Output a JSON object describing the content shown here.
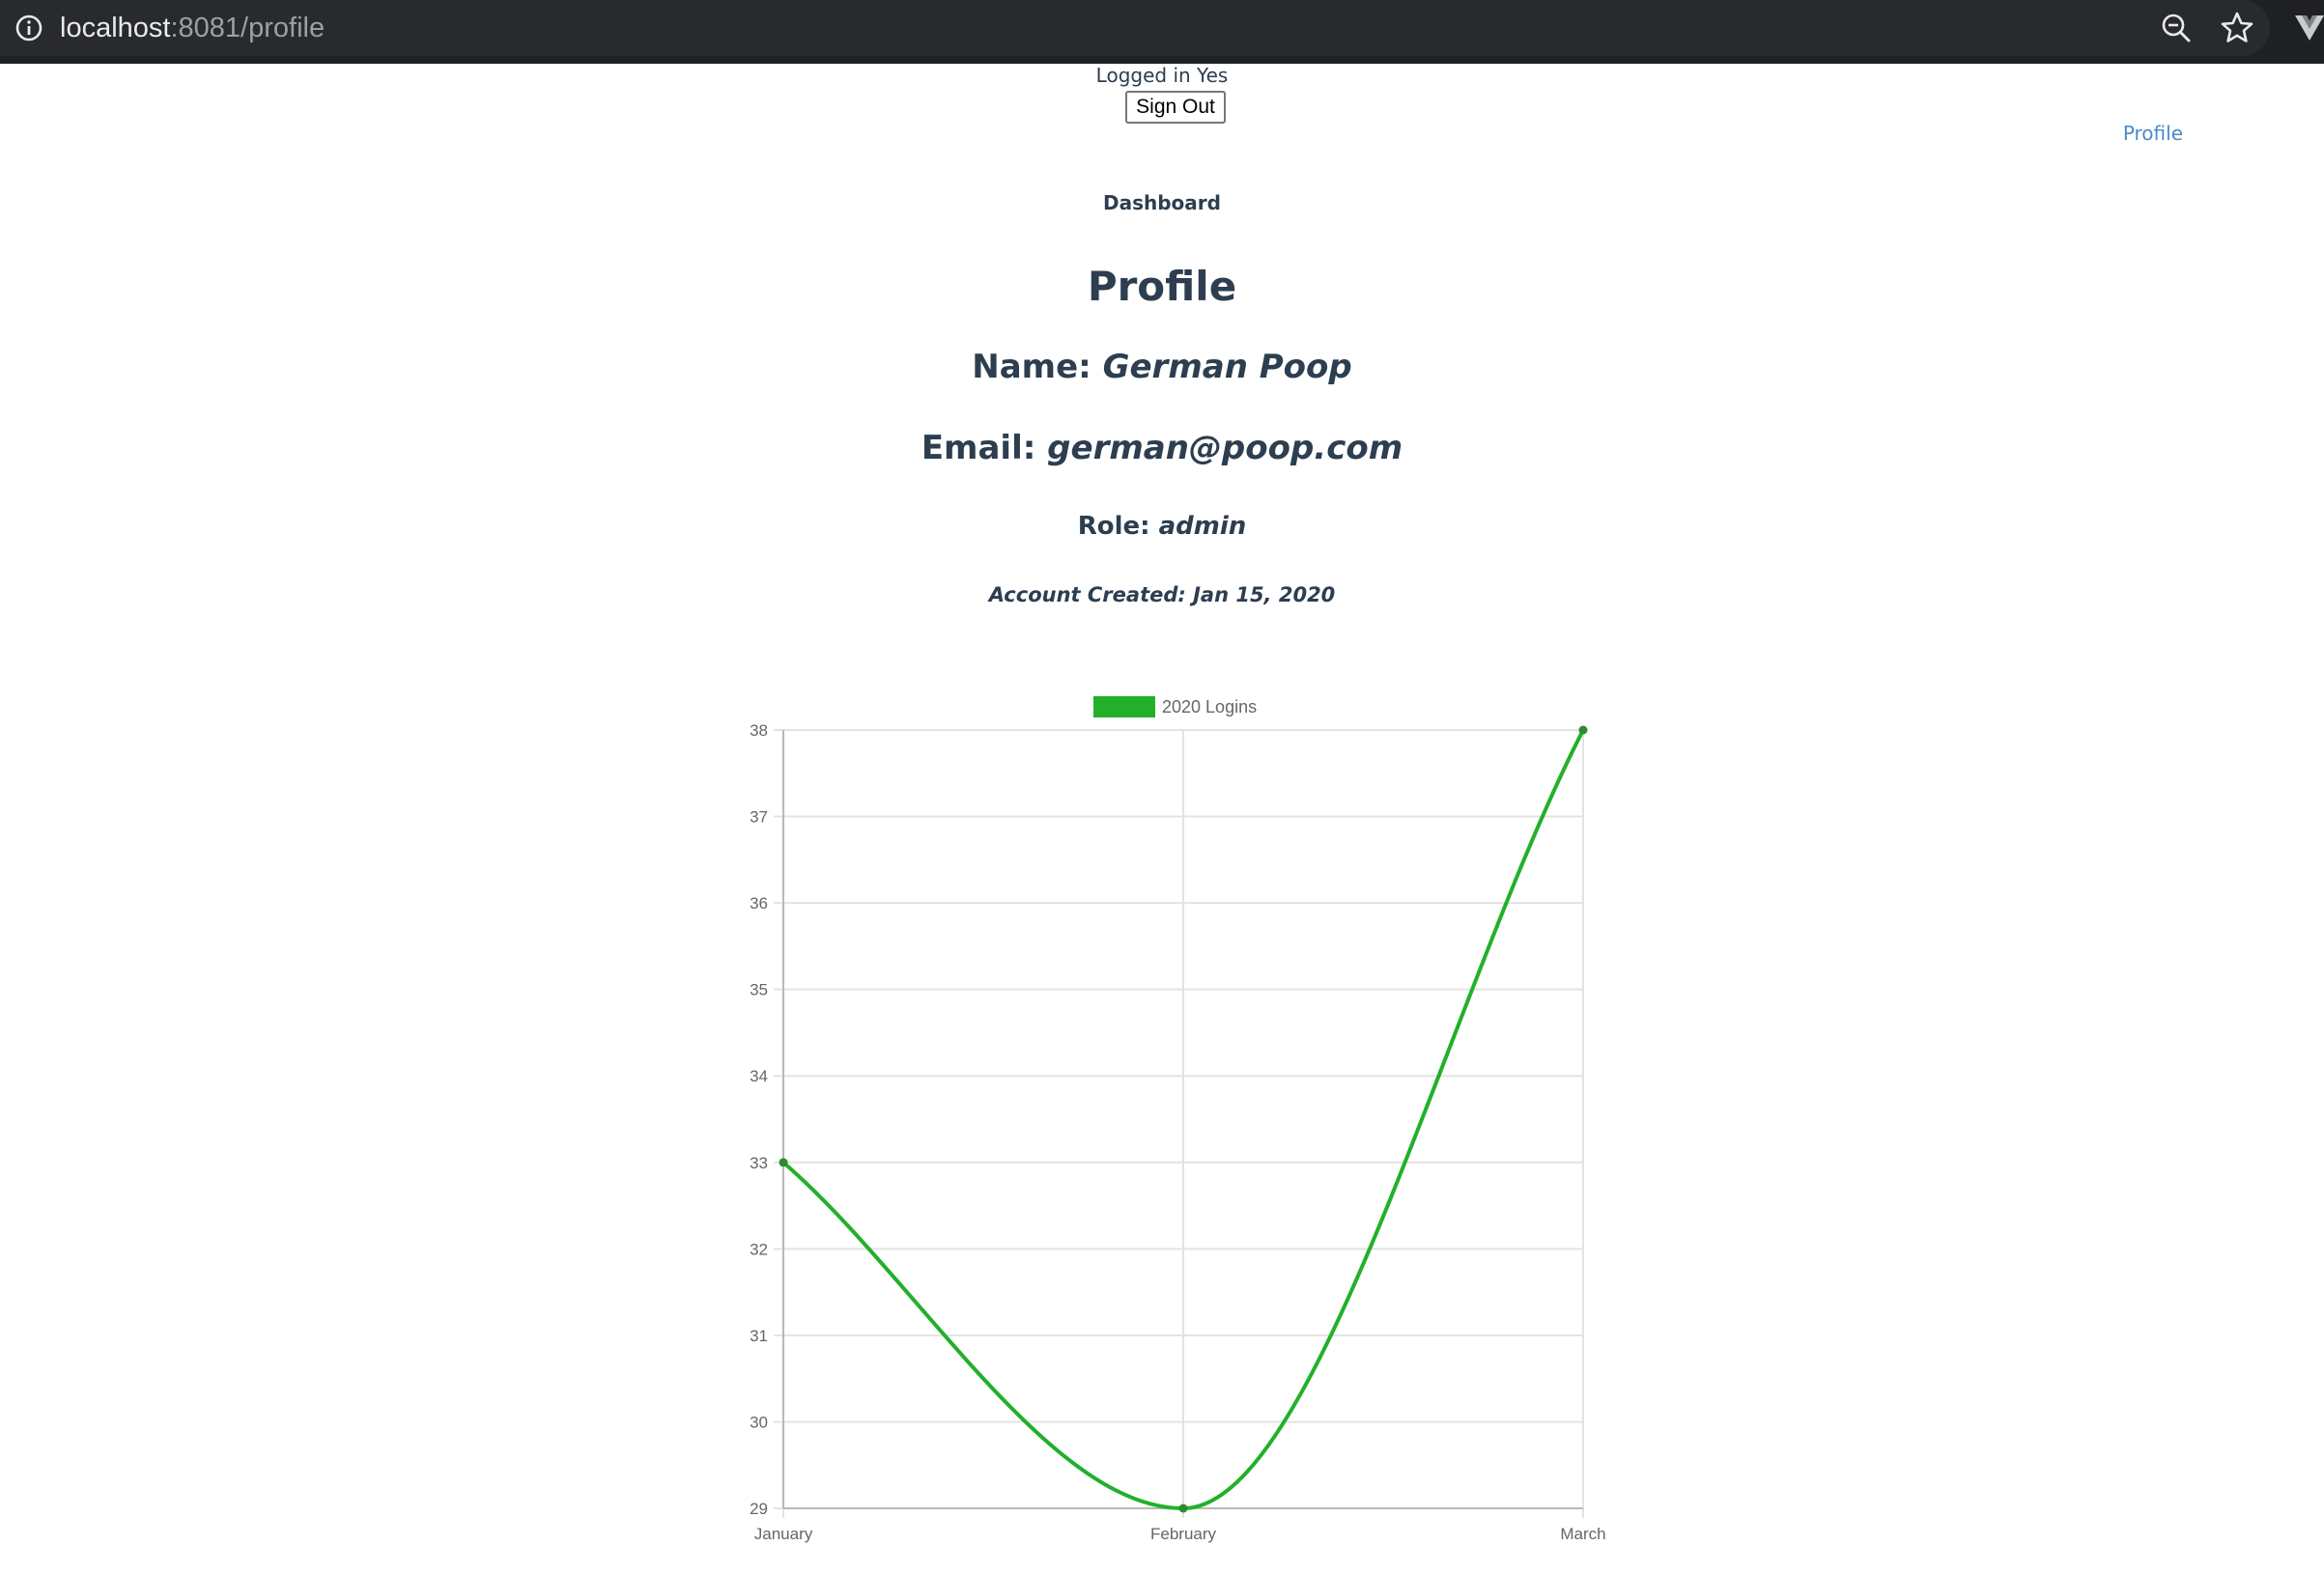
{
  "browser": {
    "url_host": "localhost",
    "url_rest": ":8081/profile"
  },
  "header": {
    "logged_in": "Logged in Yes",
    "sign_out": "Sign Out",
    "profile_link": "Profile"
  },
  "nav": {
    "dashboard": "Dashboard"
  },
  "profile": {
    "title": "Profile",
    "name_label": "Name: ",
    "name_value": "German Poop",
    "email_label": "Email: ",
    "email_value": "german@poop.com",
    "role_label": "Role: ",
    "role_value": "admin",
    "created_text": "Account Created: Jan 15, 2020"
  },
  "chart_data": {
    "type": "line",
    "categories": [
      "January",
      "February",
      "March"
    ],
    "series": [
      {
        "name": "2020 Logins",
        "values": [
          33,
          29,
          38
        ],
        "color": "#22b02a"
      }
    ],
    "ylim": [
      29,
      38
    ],
    "yticks": [
      29,
      30,
      31,
      32,
      33,
      34,
      35,
      36,
      37,
      38
    ],
    "grid": true,
    "legend": "top-center"
  }
}
